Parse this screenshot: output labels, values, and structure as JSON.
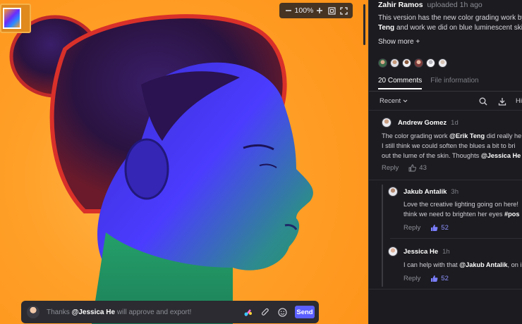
{
  "viewer": {
    "zoom": "100%",
    "composer": {
      "prefix": "Thanks",
      "mention": "@Jessica He",
      "suffix": "will approve and export!",
      "send_label": "Send"
    }
  },
  "upload": {
    "author": "Zahir Ramos",
    "meta": "uploaded 1h ago",
    "desc_line1_pre": "This version has the new color grading work by",
    "desc_line1_mention": "@",
    "desc_line2_mention": "Teng",
    "desc_line2_post": "and work we did on blue luminescent skin t",
    "show_more": "Show more +"
  },
  "tabs": [
    {
      "label": "20 Comments",
      "active": true
    },
    {
      "label": "File information",
      "active": false
    }
  ],
  "toolbar": {
    "sort_label": "Recent",
    "hide_label": "Hid"
  },
  "comments": [
    {
      "author": "Andrew Gomez",
      "time": "1d",
      "lines": [
        {
          "pre": "The color grading work",
          "mention": "@Erik Teng",
          "post": "did really he"
        },
        {
          "pre": "I still think we could soften the blues a bit to bri",
          "mention": "",
          "post": ""
        },
        {
          "pre": "out the lume of the skin. Thoughts",
          "mention": "@Jessica He",
          "post": ""
        }
      ],
      "reply_label": "Reply",
      "likes": "43"
    },
    {
      "author": "Jakub Antalik",
      "time": "3h",
      "lines": [
        {
          "pre": "Love the creative lighting going on here!",
          "mention": "",
          "post": ""
        },
        {
          "pre": "think we need to brighten her eyes",
          "mention": "#pos",
          "post": ""
        }
      ],
      "reply_label": "Reply",
      "likes": "52"
    },
    {
      "author": "Jessica He",
      "time": "1h",
      "lines": [
        {
          "pre": "I can help with that",
          "mention": "@Jakub Antalik",
          "post": ", on i"
        }
      ],
      "reply_label": "Reply",
      "likes": "52"
    }
  ],
  "colors": {
    "accent": "#5b5fff",
    "background_orange": "#ff9a1e",
    "panel_bg": "#1b1b20"
  },
  "icons": [
    "zoom-out-icon",
    "zoom-in-icon",
    "fit-screen-icon",
    "fullscreen-icon",
    "emoji-brush-icon",
    "paperclip-icon",
    "smiley-icon",
    "search-icon",
    "download-icon",
    "chevron-down-icon",
    "thumbs-up-icon"
  ]
}
